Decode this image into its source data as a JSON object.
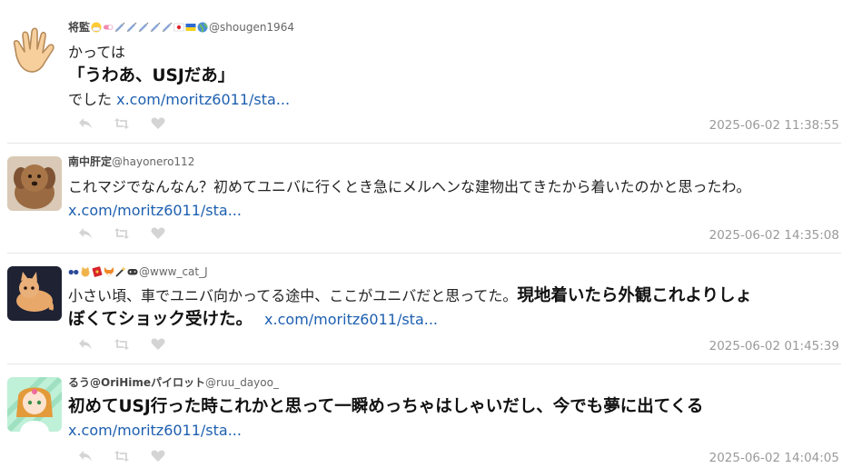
{
  "tweets": [
    {
      "name": "将監",
      "badges": [
        "face-mask-emoji",
        "pill-emoji",
        "syringe-emoji",
        "syringe-emoji",
        "syringe-emoji",
        "syringe-emoji",
        "syringe-emoji",
        "japan-flag-emoji",
        "ukraine-flag-emoji",
        "globe-emoji"
      ],
      "handle": "@shougen1964",
      "text_line1": "かっては",
      "text_line2": "「うわあ、USJだあ」",
      "text_line3": "でした",
      "link": "x.com/moritz6011/sta...",
      "time": "2025-06-02 11:38:55"
    },
    {
      "name": "南中肝定",
      "handle": "@hayonero112",
      "text": "これマジでなんなん？初めてユニバに行くとき急にメルヘンな建物出てきたから着いたのかと思ったわ。",
      "link": "x.com/moritz6011/sta...",
      "time": "2025-06-02 14:35:08"
    },
    {
      "badges": [
        "glasses-emoji",
        "cat-emoji",
        "red-envelope-emoji",
        "fox-emoji",
        "magic-wand-emoji",
        "gamepad-emoji"
      ],
      "handle": "@www_cat_J",
      "text_normal": "小さい頃、車でユニバ向かってる途中、ここがユニバだと思ってた。",
      "text_bold_1": "現地着いたら外観これよりしょ",
      "text_bold_2": "ぼくてショック受けた。",
      "link": "x.com/moritz6011/sta...",
      "time": "2025-06-02 01:45:39"
    },
    {
      "name": "るう@OriHimeパイロット",
      "handle": "@ruu_dayoo_",
      "text": "初めてUSJ行った時これかと思って一瞬めっちゃはしゃいだし、今でも夢に出てくる",
      "link": "x.com/moritz6011/sta...",
      "time": "2025-06-02 14:04:05"
    }
  ],
  "colors": {
    "link": "#1d5fb0",
    "icon": "#d4d4d4",
    "timestamp": "#9a9a9a",
    "divider": "#e6e6e6"
  }
}
